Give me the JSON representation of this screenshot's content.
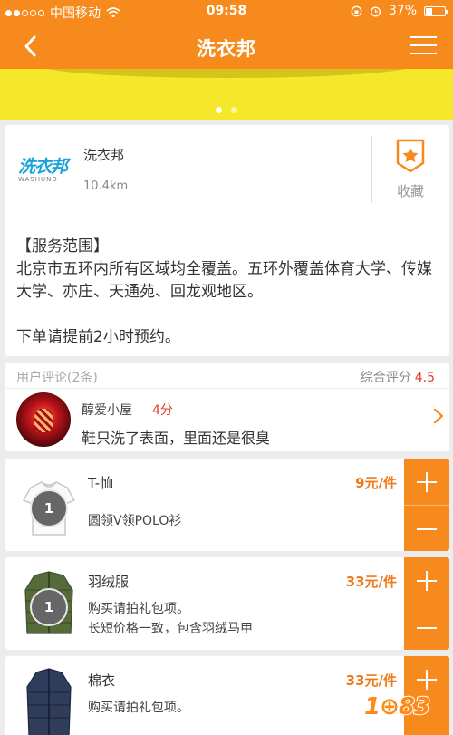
{
  "status_bar": {
    "carrier": "中国移动",
    "time": "09:58",
    "battery": "37%",
    "battery_level": 0.37
  },
  "header": {
    "title": "洗衣邦"
  },
  "banner": {
    "page_count": 2,
    "active_page": 1
  },
  "shop": {
    "logo_cn": "洗衣邦",
    "logo_en": "WASHUND",
    "name": "洗衣邦",
    "distance": "10.4km",
    "favorite_label": "收藏",
    "service_heading": "【服务范围】",
    "service_text": "北京市五环内所有区域均全覆盖。五环外覆盖体育大学、传媒大学、亦庄、天通苑、回龙观地区。",
    "order_note": "下单请提前2小时预约。"
  },
  "reviews": {
    "title": "用户评论(2条)",
    "rating_label": "综合评分",
    "rating_value": "4.5",
    "latest": {
      "user": "醇爱小屋",
      "score": "4分",
      "text": "鞋只洗了表面，里面还是很臭"
    }
  },
  "items": [
    {
      "name": "T-恤",
      "price": "9元/件",
      "desc": "圆领V领POLO衫",
      "count": "1",
      "icon": "tshirt-icon"
    },
    {
      "name": "羽绒服",
      "price": "33元/件",
      "desc": "购买请拍礼包项。\n长短价格一致，包含羽绒马甲",
      "count": "1",
      "icon": "down-jacket-icon"
    },
    {
      "name": "棉衣",
      "price": "33元/件",
      "desc": "购买请拍礼包项。",
      "icon": "cotton-coat-icon"
    }
  ],
  "watermark": {
    "text": "1⊕83"
  },
  "colors": {
    "brand_orange": "#f78a1d",
    "price_orange": "#f07a1a",
    "rating_red": "#e0402a",
    "banner_yellow": "#f5e82b",
    "logo_blue": "#19a3dd"
  }
}
